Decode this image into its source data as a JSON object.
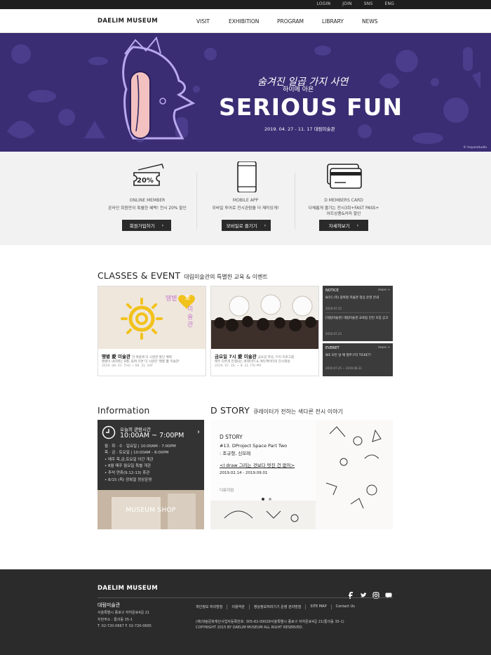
{
  "topbar": {
    "links": [
      "LOGIN",
      "JOIN",
      "SNS",
      "ENG"
    ]
  },
  "nav": {
    "logo": "DAELIM MUSEUM",
    "items": [
      "VISIT",
      "EXHIBITION",
      "PROGRAM",
      "LIBRARY",
      "NEWS"
    ]
  },
  "hero": {
    "subtitle": "숨겨진 일곱 가지 사연",
    "subtitle2": "하이메 아욘",
    "title": "SERIOUS FUN",
    "date": "2019. 04. 27 - 11. 17  대림미술관",
    "credit": "© hayonstudio",
    "bg_color": "#3a2d73"
  },
  "services": [
    {
      "icon": "coupon-20-icon",
      "coupon": "20%",
      "title": "ONLINE MEMBER",
      "desc": [
        "온라인 회원만의 특별한 혜택! 전시 20% 할인"
      ],
      "button": "회원가입하기"
    },
    {
      "icon": "smartphone-icon",
      "title": "MOBILE APP",
      "desc": [
        "모바일 투어로 전시관람을 더 재미있게!"
      ],
      "button": "모바일로 즐기기"
    },
    {
      "icon": "credit-card-icon",
      "title": "D MEMBERS CARD",
      "desc": [
        "다채롭게 즐기는 전시3회+FAST PASS+",
        "아트상품&커피 할인"
      ],
      "button": "자세히보기"
    }
  ],
  "classes": {
    "heading": "CLASSES & EVENT",
    "heading_kr": "대림미술관의 특별한 교육 & 이벤트",
    "cards": [
      {
        "badge": "땡볕",
        "badge2": "愛",
        "badge3": "미술관",
        "title": "땡볕 愛 미술관",
        "title_sub": "한 여름에 더 시원한 할인 혜택",
        "desc": "땡볕이 내리쬐는 8월, 들여 오면 더 시원한 '땡볕 愛 미술관'",
        "date": "2019. 08. 01. THU ~ 08. 31. SAT"
      },
      {
        "title": "금요일 7시 愛 미술관",
        "title_sub": "금요일 저녁, 두어 프로그램",
        "desc": "매주 다른게 진행되는 큐레이터 & 에듀케이터의 전시해설",
        "date": "2019. 07. 16. ~ 8. 31. FRI PM"
      }
    ],
    "notice": {
      "title": "NOTICE",
      "more": "more +",
      "items": [
        {
          "text": "8/15 (목) 광복절 미술관 정상 운영 안내",
          "date": "2019.07.25"
        },
        {
          "text": "[대림미술관] 대림미술관 교육팀 인턴 모집 공고",
          "date": "2019.07.23"
        }
      ]
    },
    "event": {
      "title": "EVENET",
      "more": "more +",
      "items": [
        {
          "text": "WE 모든 날 매 평주구리 TICKET!",
          "date": "2019.07.25 ~ 2019.08.31"
        }
      ]
    }
  },
  "information": {
    "heading": "Information",
    "label": "오늘의 관람시간",
    "hours": "10:00AM ~ 7:00PM",
    "details": [
      "월 · 화 · 수 · 일요일 | 10:00AM - 7:00PM",
      "목 · 금 · 토요일 | 10:00AM - 8:00PM",
      "• 매주 목,금,토요일 야간 개관",
      "• 8월 매주 월요일 특별 개관",
      "• 추석 연휴(9.12-13) 휴관",
      "• 8/15 (목) 광복절 정상운영"
    ],
    "shop": "MUSEUM SHOP"
  },
  "dstory": {
    "heading": "D STORY",
    "heading_kr": "큐레이터가 전하는 색다른 전시 이야기",
    "label": "D STORY",
    "line1": "#13. DProject Space Part Two",
    "line2": ": 조규형, 신모래",
    "line3": "<I draw 그리는 것보다 멋진 건 없어>",
    "date": "2019.02.14 - 2019.09.01",
    "link": "디뮤지엄"
  },
  "footer": {
    "logo": "DAELIM MUSEUM",
    "name": "대림미술관",
    "address": [
      "서울특별시 종로구 자하문로4길 21",
      "지번주소 : 통의동 35-1",
      "T. 02-720-0667  F. 02-720-0665"
    ],
    "links": [
      "개인정보 처리방침",
      "이용약관",
      "영상정보처리기기 운영 관리방침",
      "SITE MAP",
      "Contact Us"
    ],
    "copy1": "(재)대림문화재단사업자등록번호: 305-82-09028서울특별시 종로구 자하문로4길 21(통의동 35-1)",
    "copy2": "COPYRIGHT 2015 BY DAELIM MUSEUM ALL RIGHT RESERVED.",
    "sns": [
      "facebook-icon",
      "twitter-icon",
      "instagram-icon",
      "chat-icon"
    ]
  }
}
